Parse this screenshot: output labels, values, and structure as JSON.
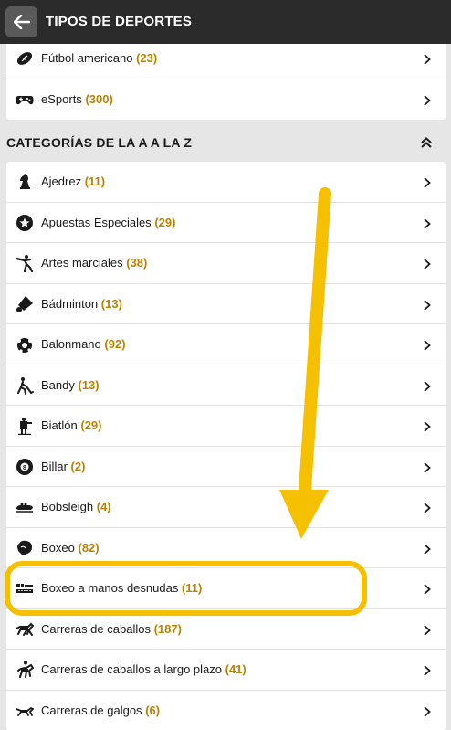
{
  "header": {
    "title": "TIPOS DE DEPORTES",
    "back_icon": "arrow-left-icon"
  },
  "top_list": [
    {
      "label": "Fútbol americano",
      "count": "(23)",
      "icon": "american-football-icon"
    },
    {
      "label": "eSports",
      "count": "(300)",
      "icon": "gamepad-icon"
    }
  ],
  "section": {
    "title": "CATEGORÍAS DE LA A A LA Z",
    "collapse_icon": "double-chevron-up-icon"
  },
  "categories": [
    {
      "label": "Ajedrez",
      "count": "(11)",
      "icon": "chess-knight-icon"
    },
    {
      "label": "Apuestas Especiales",
      "count": "(29)",
      "icon": "star-circle-icon"
    },
    {
      "label": "Artes marciales",
      "count": "(38)",
      "icon": "martial-arts-icon"
    },
    {
      "label": "Bádminton",
      "count": "(13)",
      "icon": "shuttlecock-icon"
    },
    {
      "label": "Balonmano",
      "count": "(92)",
      "icon": "handball-icon"
    },
    {
      "label": "Bandy",
      "count": "(13)",
      "icon": "bandy-player-icon"
    },
    {
      "label": "Biatlón",
      "count": "(29)",
      "icon": "biathlon-icon"
    },
    {
      "label": "Billar",
      "count": "(2)",
      "icon": "billiard-ball-icon"
    },
    {
      "label": "Bobsleigh",
      "count": "(4)",
      "icon": "bobsleigh-icon"
    },
    {
      "label": "Boxeo",
      "count": "(82)",
      "icon": "boxing-glove-icon"
    },
    {
      "label": "Boxeo a manos desnudas",
      "count": "(11)",
      "icon": "bare-knuckle-icon"
    },
    {
      "label": "Carreras de caballos",
      "count": "(187)",
      "icon": "horse-racing-icon"
    },
    {
      "label": "Carreras de caballos a largo plazo",
      "count": "(41)",
      "icon": "horse-rider-icon"
    },
    {
      "label": "Carreras de galgos",
      "count": "(6)",
      "icon": "greyhound-icon"
    }
  ],
  "colors": {
    "header_bg": "#2b2b2b",
    "count_color": "#b98300",
    "highlight": "#f5c000"
  }
}
